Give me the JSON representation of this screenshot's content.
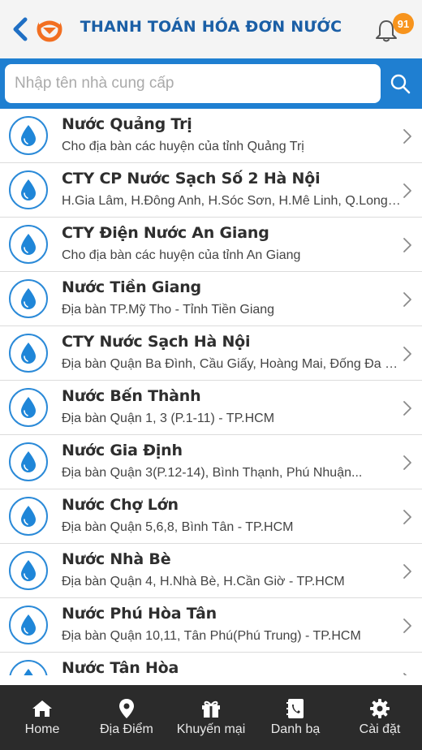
{
  "header": {
    "title": "THANH TOÁN HÓA ĐƠN NƯỚC",
    "notification_count": "91"
  },
  "search": {
    "placeholder": "Nhập tên nhà cung cấp"
  },
  "providers": [
    {
      "name": "Nước Quảng Trị",
      "desc": "Cho địa bàn các huyện của tỉnh Quảng Trị"
    },
    {
      "name": "CTY CP Nước Sạch Số 2 Hà Nội",
      "desc": "H.Gia Lâm, H.Đông Anh, H.Sóc Sơn, H.Mê Linh, Q.Long Biên"
    },
    {
      "name": "CTY Điện Nước An Giang",
      "desc": "Cho địa bàn các huyện của tỉnh An Giang"
    },
    {
      "name": "Nước Tiền Giang",
      "desc": "Địa bàn TP.Mỹ Tho - Tỉnh Tiền Giang"
    },
    {
      "name": "CTY Nước Sạch Hà Nội",
      "desc": "Địa bàn Quận Ba Đình, Cầu Giấy, Hoàng Mai, Đống Đa - TP.Hà Nội"
    },
    {
      "name": "Nước Bến Thành",
      "desc": "Địa bàn Quận 1, 3 (P.1-11) - TP.HCM"
    },
    {
      "name": "Nước Gia Định",
      "desc": "Địa bàn Quận 3(P.12-14), Bình Thạnh, Phú Nhuận..."
    },
    {
      "name": "Nước Chợ Lớn",
      "desc": "Địa bàn Quận 5,6,8, Bình Tân - TP.HCM"
    },
    {
      "name": "Nước Nhà Bè",
      "desc": "Địa bàn Quận 4, H.Nhà Bè, H.Cần Giờ - TP.HCM"
    },
    {
      "name": "Nước Phú Hòa Tân",
      "desc": "Địa bàn Quận 10,11, Tân Phú(Phú Trung) - TP.HCM"
    },
    {
      "name": "Nước Tân Hòa",
      "desc": ""
    }
  ],
  "bottom_nav": [
    {
      "label": "Home",
      "icon": "home-icon"
    },
    {
      "label": "Địa Điểm",
      "icon": "location-pin-icon"
    },
    {
      "label": "Khuyến mại",
      "icon": "gift-icon"
    },
    {
      "label": "Danh bạ",
      "icon": "contacts-book-icon"
    },
    {
      "label": "Cài đặt",
      "icon": "gear-icon"
    }
  ],
  "colors": {
    "primary_blue": "#1f7fd1",
    "title_blue": "#1b5fa6",
    "accent_orange": "#f7941d",
    "nav_bg": "#2b2b2b"
  }
}
